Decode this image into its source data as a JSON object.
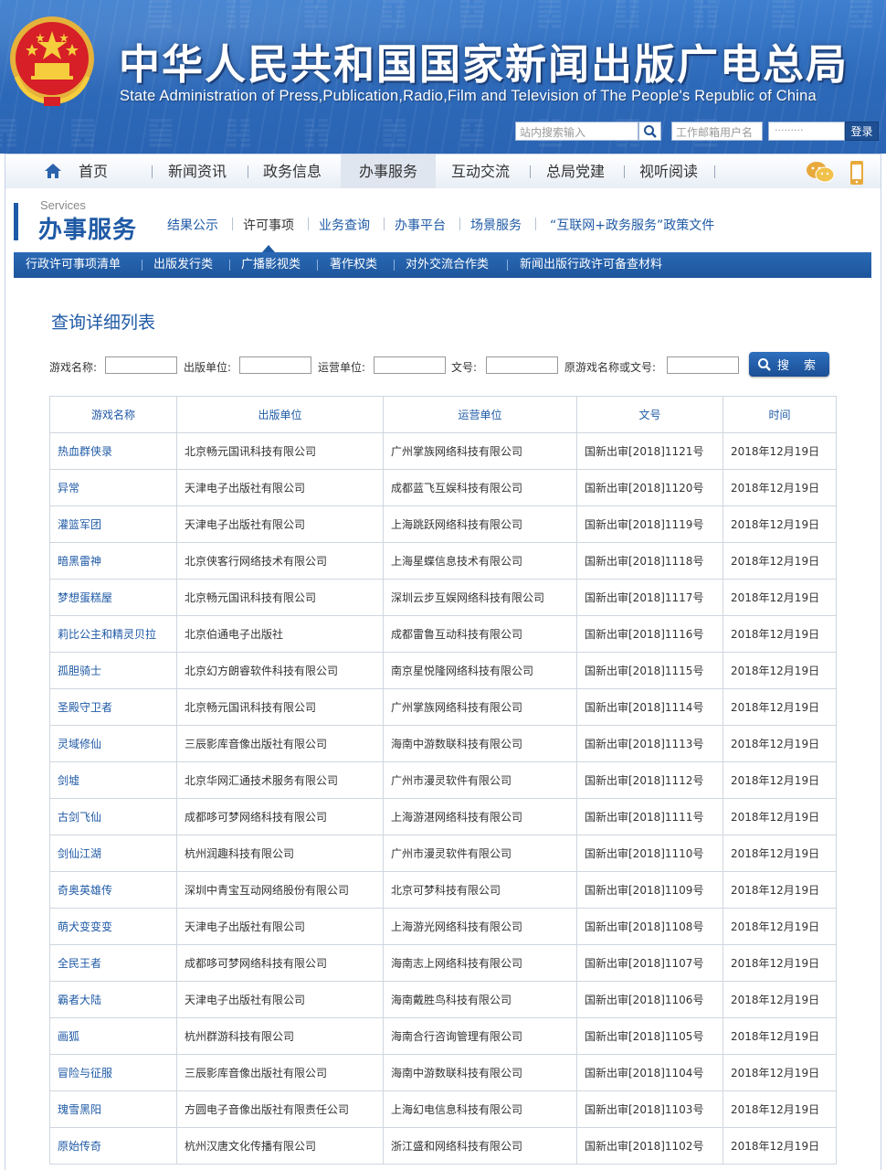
{
  "header": {
    "title_cn": "中华人民共和国国家新闻出版广电总局",
    "title_en": "State Administration of Press,Publication,Radio,Film and Television of The People's Republic of China",
    "search_placeholder": "站内搜索输入",
    "mail_placeholder": "工作邮箱用户名",
    "password_placeholder": "·········",
    "login_label": "登录"
  },
  "nav": {
    "items": [
      {
        "label": "首页"
      },
      {
        "label": "新闻资讯"
      },
      {
        "label": "政务信息"
      },
      {
        "label": "办事服务"
      },
      {
        "label": "互动交流"
      },
      {
        "label": "总局党建"
      },
      {
        "label": "视听阅读"
      }
    ],
    "active": "办事服务"
  },
  "services": {
    "label_en": "Services",
    "label_cn": "办事服务",
    "tabs": [
      {
        "label": "结果公示"
      },
      {
        "label": "许可事项"
      },
      {
        "label": "业务查询"
      },
      {
        "label": "办事平台"
      },
      {
        "label": "场景服务"
      },
      {
        "label": "“互联网+政务服务”政策文件"
      }
    ],
    "active_tab": "许可事项",
    "categories": [
      {
        "label": "行政许可事项清单"
      },
      {
        "label": "出版发行类"
      },
      {
        "label": "广播影视类"
      },
      {
        "label": "著作权类"
      },
      {
        "label": "对外交流合作类"
      },
      {
        "label": "新闻出版行政许可备查材料"
      }
    ]
  },
  "content": {
    "title": "查询详细列表",
    "filters": {
      "game_name": "游戏名称:",
      "publisher": "出版单位:",
      "operator": "运营单位:",
      "doc_no": "文号:",
      "orig": "原游戏名称或文号:"
    },
    "query_label": "搜 索"
  },
  "table": {
    "headers": [
      "游戏名称",
      "出版单位",
      "运营单位",
      "文号",
      "时间"
    ],
    "rows": [
      [
        "热血群侠录",
        "北京畅元国讯科技有限公司",
        "广州掌族网络科技有限公司",
        "国新出审[2018]1121号",
        "2018年12月19日"
      ],
      [
        "异常",
        "天津电子出版社有限公司",
        "成都蓝飞互娱科技有限公司",
        "国新出审[2018]1120号",
        "2018年12月19日"
      ],
      [
        "灌篮军团",
        "天津电子出版社有限公司",
        "上海跳跃网络科技有限公司",
        "国新出审[2018]1119号",
        "2018年12月19日"
      ],
      [
        "暗黑雷神",
        "北京侠客行网络技术有限公司",
        "上海星蝶信息技术有限公司",
        "国新出审[2018]1118号",
        "2018年12月19日"
      ],
      [
        "梦想蛋糕屋",
        "北京畅元国讯科技有限公司",
        "深圳云步互娱网络科技有限公司",
        "国新出审[2018]1117号",
        "2018年12月19日"
      ],
      [
        "莉比公主和精灵贝拉",
        "北京伯通电子出版社",
        "成都雷鲁互动科技有限公司",
        "国新出审[2018]1116号",
        "2018年12月19日"
      ],
      [
        "孤胆骑士",
        "北京幻方朗睿软件科技有限公司",
        "南京星悦隆网络科技有限公司",
        "国新出审[2018]1115号",
        "2018年12月19日"
      ],
      [
        "圣殿守卫者",
        "北京畅元国讯科技有限公司",
        "广州掌族网络科技有限公司",
        "国新出审[2018]1114号",
        "2018年12月19日"
      ],
      [
        "灵域修仙",
        "三辰影库音像出版社有限公司",
        "海南中游数联科技有限公司",
        "国新出审[2018]1113号",
        "2018年12月19日"
      ],
      [
        "剑墟",
        "北京华网汇通技术服务有限公司",
        "广州市漫灵软件有限公司",
        "国新出审[2018]1112号",
        "2018年12月19日"
      ],
      [
        "古剑飞仙",
        "成都哆可梦网络科技有限公司",
        "上海游湛网络科技有限公司",
        "国新出审[2018]1111号",
        "2018年12月19日"
      ],
      [
        "剑仙江湖",
        "杭州润趣科技有限公司",
        "广州市漫灵软件有限公司",
        "国新出审[2018]1110号",
        "2018年12月19日"
      ],
      [
        "奇奥英雄传",
        "深圳中青宝互动网络股份有限公司",
        "北京可梦科技有限公司",
        "国新出审[2018]1109号",
        "2018年12月19日"
      ],
      [
        "萌犬变变变",
        "天津电子出版社有限公司",
        "上海游光网络科技有限公司",
        "国新出审[2018]1108号",
        "2018年12月19日"
      ],
      [
        "全民王者",
        "成都哆可梦网络科技有限公司",
        "海南志上网络科技有限公司",
        "国新出审[2018]1107号",
        "2018年12月19日"
      ],
      [
        "霸者大陆",
        "天津电子出版社有限公司",
        "海南戴胜鸟科技有限公司",
        "国新出审[2018]1106号",
        "2018年12月19日"
      ],
      [
        "画狐",
        "杭州群游科技有限公司",
        "海南合行咨询管理有限公司",
        "国新出审[2018]1105号",
        "2018年12月19日"
      ],
      [
        "冒险与征服",
        "三辰影库音像出版社有限公司",
        "海南中游数联科技有限公司",
        "国新出审[2018]1104号",
        "2018年12月19日"
      ],
      [
        "瑰雪黑阳",
        "方圆电子音像出版社有限责任公司",
        "上海幻电信息科技有限公司",
        "国新出审[2018]1103号",
        "2018年12月19日"
      ],
      [
        "原始传奇",
        "杭州汉唐文化传播有限公司",
        "浙江盛和网络科技有限公司",
        "国新出审[2018]1102号",
        "2018年12月19日"
      ]
    ]
  },
  "colors": {
    "banner": "#2d69b9",
    "brand_blue": "#1f5aa6",
    "category_bar": "#1d559c"
  }
}
